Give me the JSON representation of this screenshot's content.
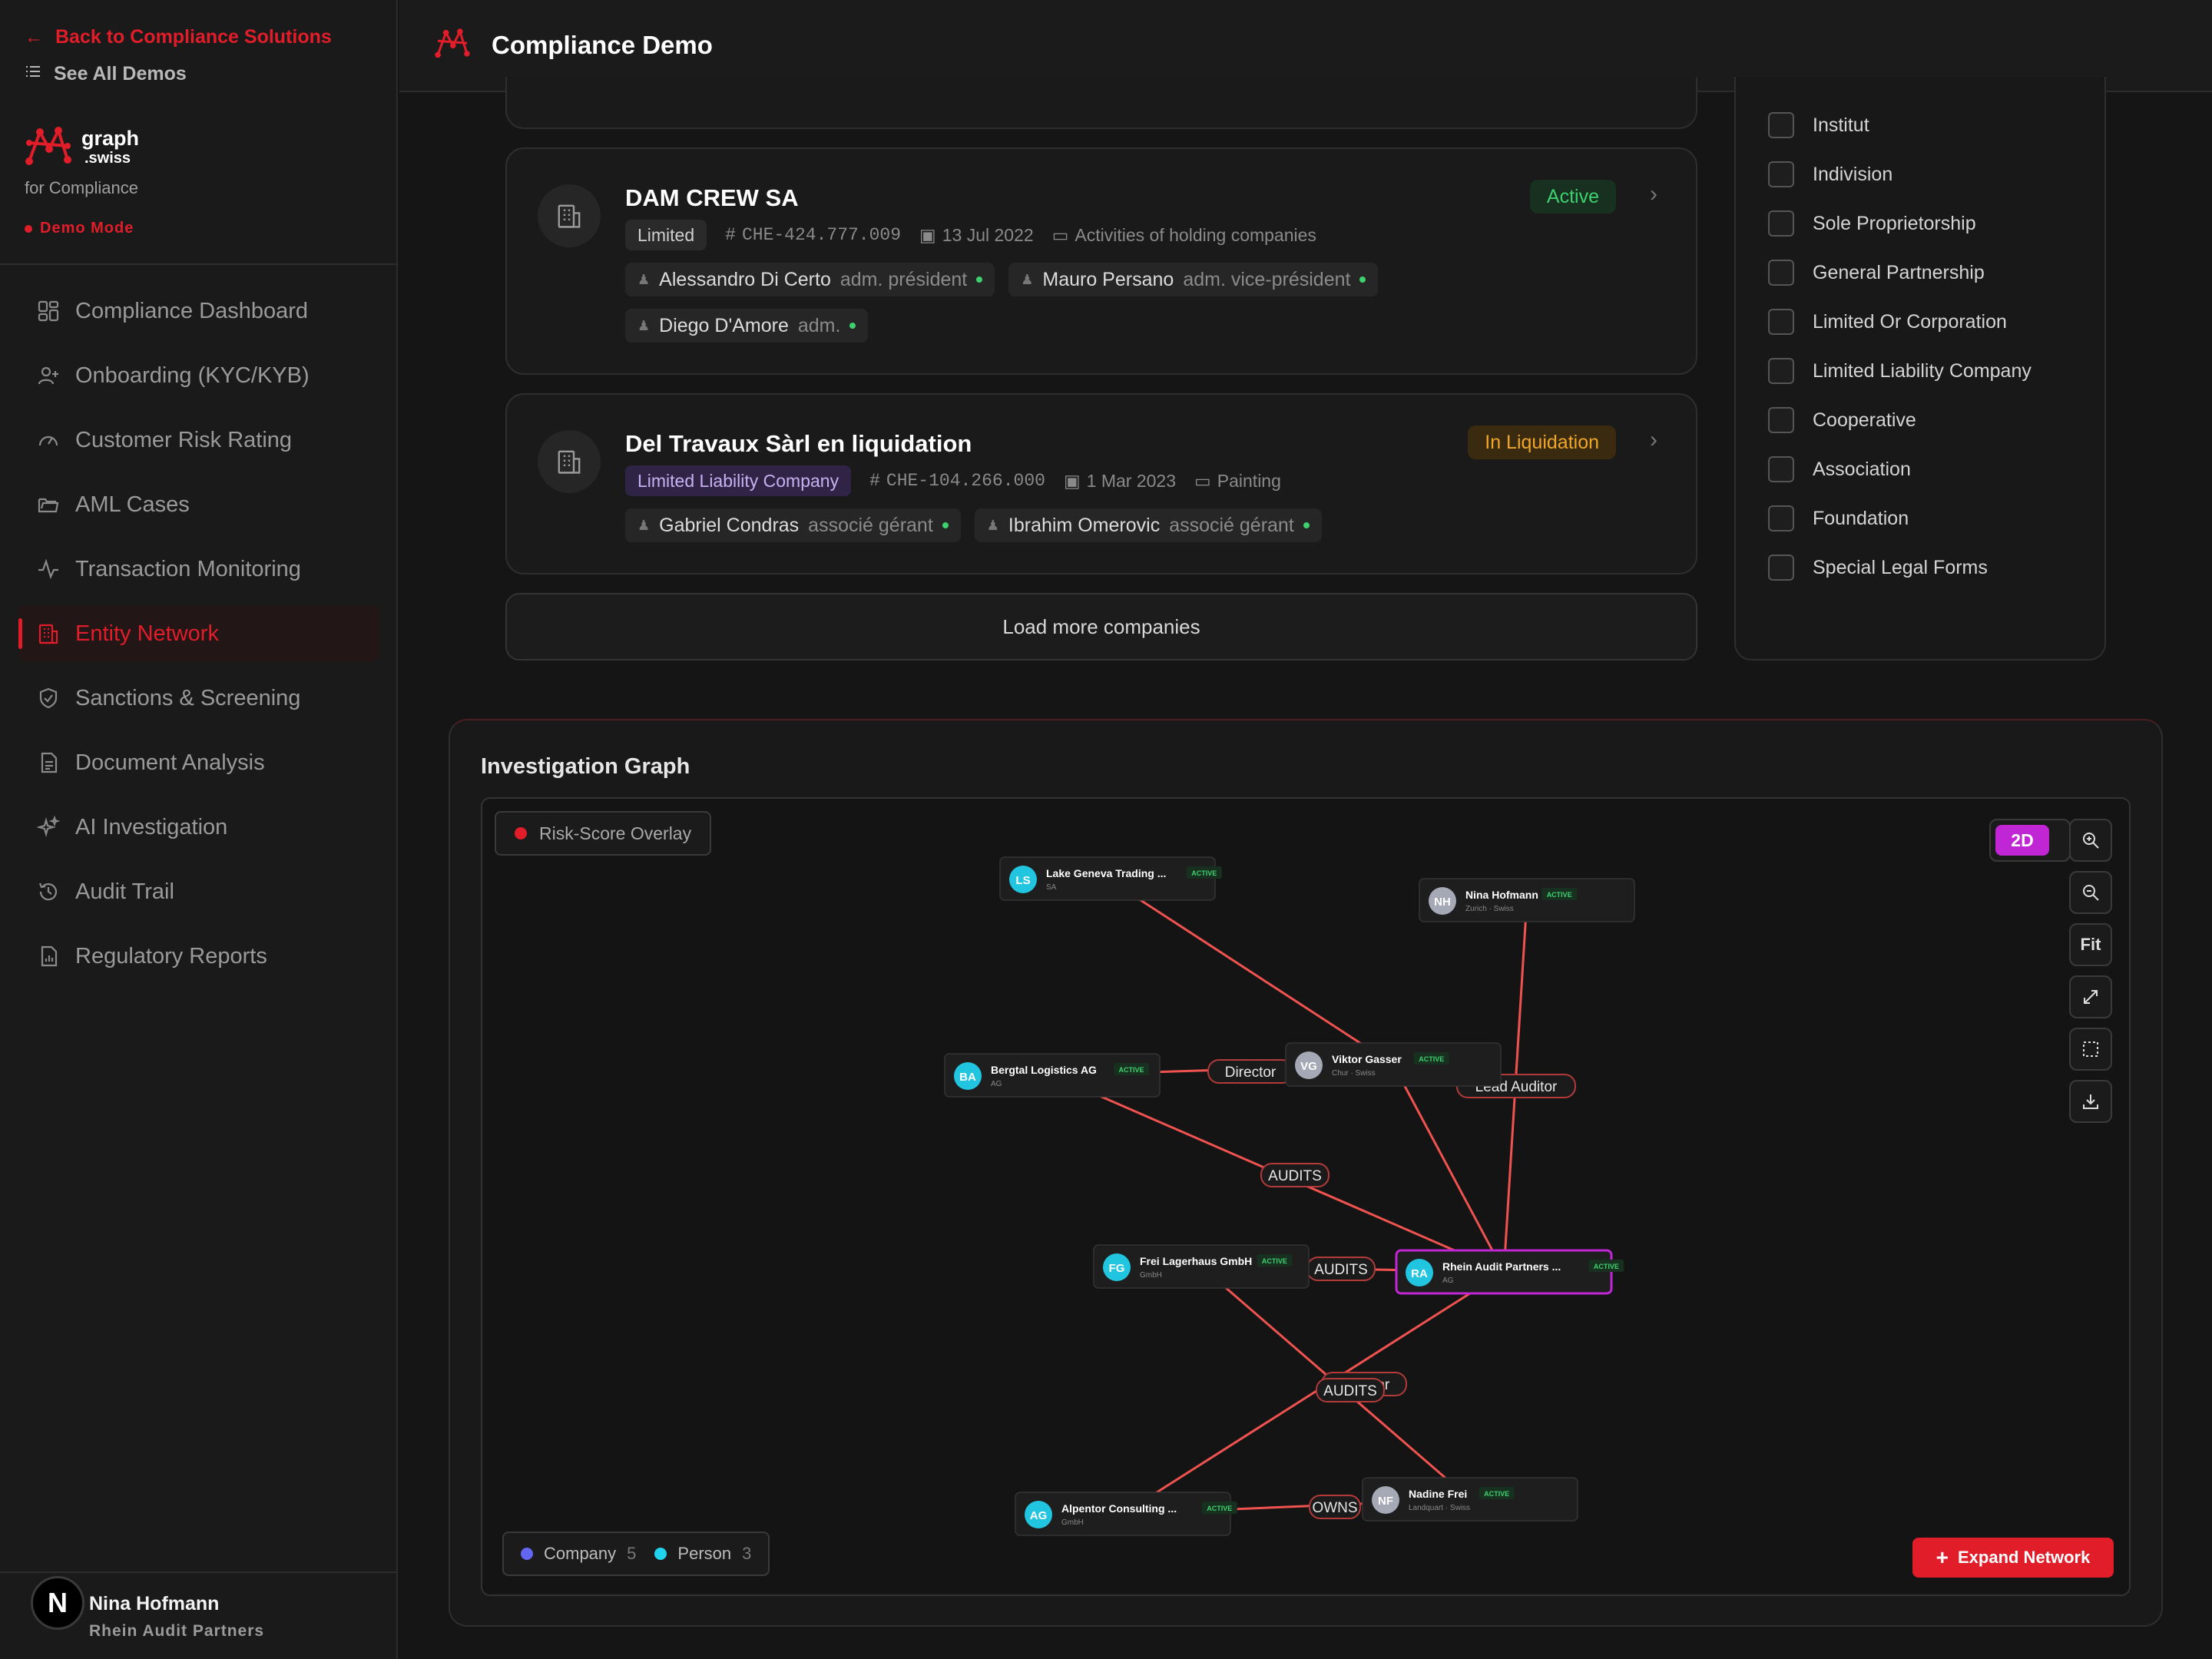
{
  "sidebar": {
    "back_label": "Back to Compliance Solutions",
    "see_all_label": "See All Demos",
    "brand_name": "graph",
    "brand_tld": ".swiss",
    "brand_sub": "for Compliance",
    "demo_mode": "Demo Mode",
    "items": [
      {
        "label": "Compliance Dashboard",
        "icon": "dashboard-icon"
      },
      {
        "label": "Onboarding (KYC/KYB)",
        "icon": "user-plus-icon"
      },
      {
        "label": "Customer Risk Rating",
        "icon": "gauge-icon"
      },
      {
        "label": "AML Cases",
        "icon": "folder-icon"
      },
      {
        "label": "Transaction Monitoring",
        "icon": "activity-icon"
      },
      {
        "label": "Entity Network",
        "icon": "building-icon",
        "active": true
      },
      {
        "label": "Sanctions & Screening",
        "icon": "shield-icon"
      },
      {
        "label": "Document Analysis",
        "icon": "document-icon"
      },
      {
        "label": "AI Investigation",
        "icon": "sparkle-icon"
      },
      {
        "label": "Audit Trail",
        "icon": "history-icon"
      },
      {
        "label": "Regulatory Reports",
        "icon": "report-icon"
      }
    ],
    "user": {
      "initial": "N",
      "name": "Nina Hofmann",
      "org": "Rhein Audit Partners"
    }
  },
  "header": {
    "title": "Compliance Demo"
  },
  "companies": [
    {
      "name": "DAM CREW SA",
      "status": "Active",
      "legal_form": "Limited",
      "uid": "CHE-424.777.009",
      "date": "13 Jul 2022",
      "industry": "Activities of holding companies",
      "people": [
        {
          "name": "Alessandro Di Certo",
          "role": "adm. président"
        },
        {
          "name": "Mauro Persano",
          "role": "adm. vice-président"
        },
        {
          "name": "Diego D'Amore",
          "role": "adm."
        }
      ]
    },
    {
      "name": "Del Travaux Sàrl en liquidation",
      "status": "In Liquidation",
      "legal_form": "Limited Liability Company",
      "uid": "CHE-104.266.000",
      "date": "1 Mar 2023",
      "industry": "Painting",
      "people": [
        {
          "name": "Gabriel Condras",
          "role": "associé gérant"
        },
        {
          "name": "Ibrahim Omerovic",
          "role": "associé gérant"
        }
      ]
    }
  ],
  "load_more": "Load more companies",
  "filters": [
    "Institut",
    "Indivision",
    "Sole Proprietorship",
    "General Partnership",
    "Limited Or Corporation",
    "Limited Liability Company",
    "Cooperative",
    "Association",
    "Foundation",
    "Special Legal Forms"
  ],
  "graph": {
    "title": "Investigation Graph",
    "overlay_label": "Risk-Score Overlay",
    "mode_label": "2D",
    "fit_label": "Fit",
    "expand_label": "Expand Network",
    "legend": [
      {
        "label": "Company",
        "count": "5",
        "color": "#6366f1"
      },
      {
        "label": "Person",
        "count": "3",
        "color": "#22d3ee"
      }
    ],
    "nodes": [
      {
        "id": "ls",
        "initials": "LS",
        "name": "Lake Geneva Trading ...",
        "sub": "SA",
        "badge": "ACTIVE",
        "type": "company"
      },
      {
        "id": "nh",
        "initials": "NH",
        "name": "Nina Hofmann",
        "sub": "Zurich · Swiss",
        "badge": "ACTIVE",
        "type": "person"
      },
      {
        "id": "ba",
        "initials": "BA",
        "name": "Bergtal Logistics AG",
        "sub": "AG",
        "badge": "ACTIVE",
        "type": "company"
      },
      {
        "id": "vg",
        "initials": "VG",
        "name": "Viktor Gasser",
        "sub": "Chur · Swiss",
        "badge": "ACTIVE",
        "type": "person"
      },
      {
        "id": "fg",
        "initials": "FG",
        "name": "Frei Lagerhaus GmbH",
        "sub": "GmbH",
        "badge": "ACTIVE",
        "type": "company"
      },
      {
        "id": "ra",
        "initials": "RA",
        "name": "Rhein Audit Partners ...",
        "sub": "AG",
        "badge": "ACTIVE",
        "type": "company",
        "selected": true
      },
      {
        "id": "ac",
        "initials": "AG",
        "name": "Alpentor Consulting ...",
        "sub": "GmbH",
        "badge": "ACTIVE",
        "type": "company"
      },
      {
        "id": "nf",
        "initials": "NF",
        "name": "Nadine Frei",
        "sub": "Landquart · Swiss",
        "badge": "ACTIVE",
        "type": "person"
      }
    ],
    "edges": [
      {
        "from": "ls",
        "to": "vg",
        "label": ""
      },
      {
        "from": "ba",
        "to": "vg",
        "label": "Director"
      },
      {
        "from": "nh",
        "to": "ra",
        "label": "Lead Auditor"
      },
      {
        "from": "ba",
        "to": "ra",
        "label": "AUDITS"
      },
      {
        "from": "vg",
        "to": "ra",
        "label": ""
      },
      {
        "from": "fg",
        "to": "ra",
        "label": "AUDITS"
      },
      {
        "from": "fg",
        "to": "nf",
        "label": "Director"
      },
      {
        "from": "ra",
        "to": "ac",
        "label": "AUDITS"
      },
      {
        "from": "ac",
        "to": "nf",
        "label": "OWNS"
      }
    ]
  }
}
